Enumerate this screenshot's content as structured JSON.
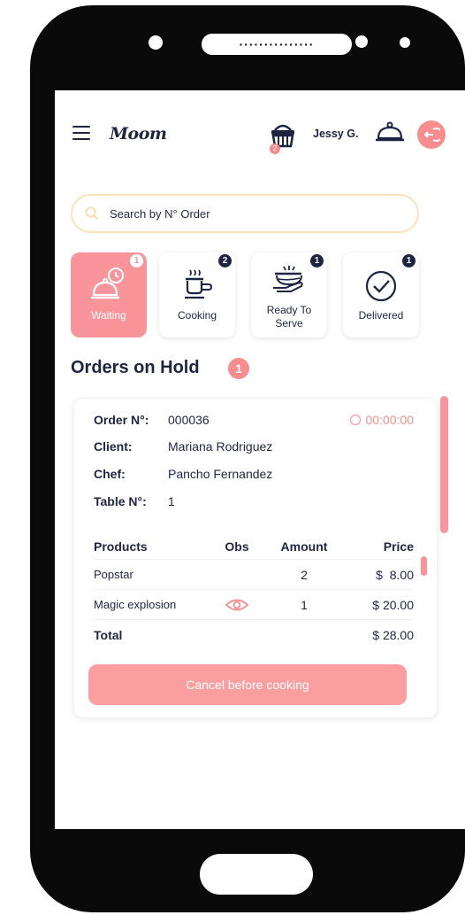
{
  "app": {
    "logo": "Moom"
  },
  "header": {
    "username": "Jessy G.",
    "cart_count": "2"
  },
  "search": {
    "placeholder": "Search by N° Order"
  },
  "tabs": [
    {
      "label": "Waiting",
      "count": "1",
      "active": true,
      "icon": "cloche-clock-icon"
    },
    {
      "label": "Cooking",
      "count": "2",
      "active": false,
      "icon": "cooking-pot-icon"
    },
    {
      "label": "Ready To Serve",
      "count": "1",
      "active": false,
      "icon": "serving-hand-icon"
    },
    {
      "label": "Delivered",
      "count": "1",
      "active": false,
      "icon": "check-circle-icon"
    }
  ],
  "section": {
    "title": "Orders on Hold",
    "count": "1"
  },
  "order": {
    "number_label": "Order N°:",
    "number": "000036",
    "client_label": "Client:",
    "client": "Mariana Rodriguez",
    "chef_label": "Chef:",
    "chef": "Pancho Fernandez",
    "table_label": "Table N°:",
    "table": "1",
    "timer": "00:00:00",
    "columns": {
      "products": "Products",
      "obs": "Obs",
      "amount": "Amount",
      "price": "Price"
    },
    "items": [
      {
        "name": "Popstar",
        "amount": "2",
        "price": "$  8.00",
        "obs": false
      },
      {
        "name": "Magic explosion",
        "amount": "1",
        "price": "$ 20.00",
        "obs": true
      }
    ],
    "total_label": "Total",
    "total": "$ 28.00",
    "cancel_label": "Cancel before cooking"
  },
  "colors": {
    "accent": "#f98c8c",
    "navy": "#1e2542",
    "search_border": "#fbe3b8"
  }
}
